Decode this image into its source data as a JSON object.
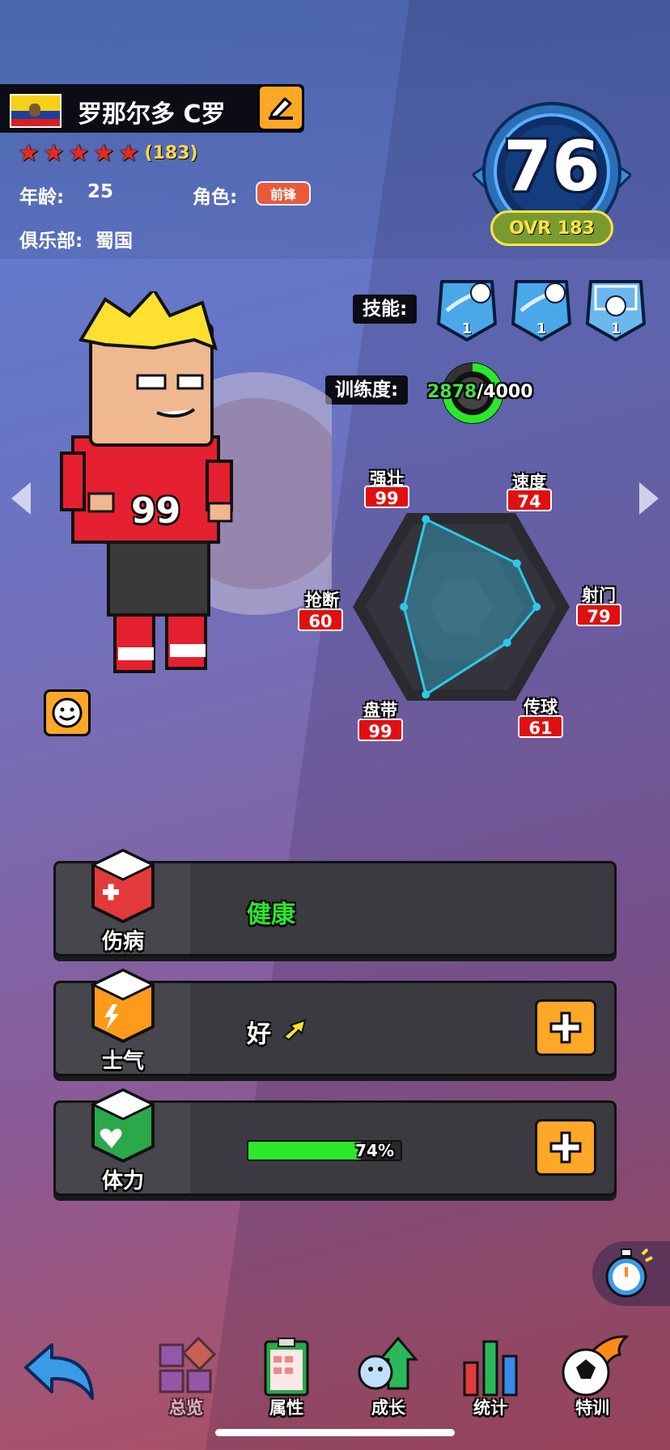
{
  "player": {
    "name": "罗那尔多 C罗",
    "star_count": 5,
    "stars_total": "(183)",
    "age_label": "年龄:",
    "age_value": "25",
    "role_label": "角色:",
    "role_value": "前锋",
    "club_label": "俱乐部:",
    "club_value": "蜀国",
    "jersey_number": "99"
  },
  "rating": {
    "value": "76",
    "ovr": "OVR 183"
  },
  "skills": {
    "label": "技能:",
    "items": [
      {
        "icon": "ball-dash-skill-icon",
        "level": "1"
      },
      {
        "icon": "ball-dash-skill-icon",
        "level": "1"
      },
      {
        "icon": "goal-shot-skill-icon",
        "level": "1"
      }
    ]
  },
  "training": {
    "label": "训练度:",
    "current": "2878",
    "max": "/4000",
    "progress": 0.72
  },
  "stats": {
    "strength": {
      "label": "强壮",
      "value": "99"
    },
    "speed": {
      "label": "速度",
      "value": "74"
    },
    "shooting": {
      "label": "射门",
      "value": "79"
    },
    "passing": {
      "label": "传球",
      "value": "61"
    },
    "dribbling": {
      "label": "盘带",
      "value": "99"
    },
    "tackling": {
      "label": "抢断",
      "value": "60"
    }
  },
  "status": {
    "injury": {
      "title": "伤病",
      "value": "健康"
    },
    "morale": {
      "title": "士气",
      "value": "好"
    },
    "stamina": {
      "title": "体力",
      "percent_text": "74%",
      "percent": 0.74
    }
  },
  "nav": {
    "overview": "总览",
    "attributes": "属性",
    "growth": "成长",
    "statistics": "统计",
    "special_training": "特训"
  },
  "colors": {
    "accent_orange": "#ffa726",
    "stat_red": "#e01010",
    "healthy_green": "#2be82b",
    "radar_cyan": "#2ec8e8"
  }
}
